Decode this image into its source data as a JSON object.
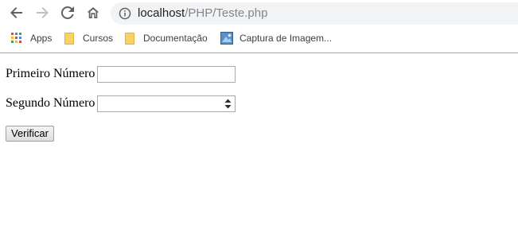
{
  "browser": {
    "url_host": "localhost",
    "url_path": "/PHP/Teste.php"
  },
  "bookmarks": [
    {
      "label": "Apps",
      "icon": "apps-grid-icon"
    },
    {
      "label": "Cursos",
      "icon": "folder-icon"
    },
    {
      "label": "Documentação",
      "icon": "folder-icon"
    },
    {
      "label": "Captura de Imagem...",
      "icon": "capture-icon"
    }
  ],
  "form": {
    "first_label": "Primeiro Número",
    "first_value": "",
    "second_label": "Segundo Número",
    "second_value": "",
    "submit_label": "Verificar"
  },
  "colors": {
    "folder": "#fad165",
    "omnibox_bg": "#f1f3f4",
    "url_path": "#80868b"
  }
}
